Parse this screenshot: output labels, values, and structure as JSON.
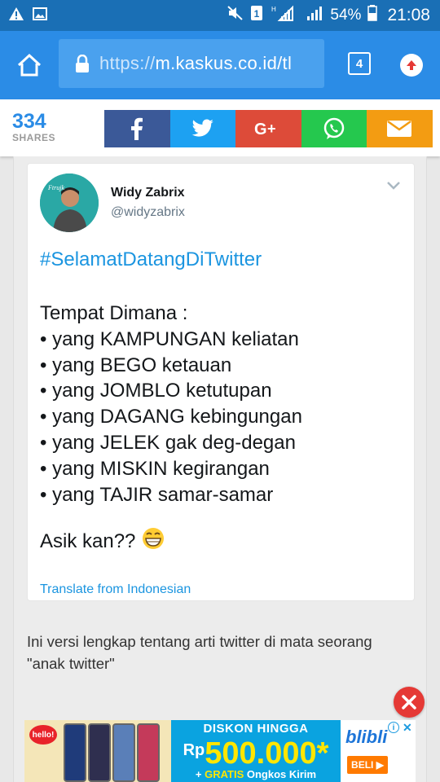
{
  "status_bar": {
    "battery_percent": "54%",
    "time": "21:08"
  },
  "browser": {
    "url_scheme": "https://",
    "url_rest": "m.kaskus.co.id/tl",
    "tab_count": "4"
  },
  "share_bar": {
    "count": "334",
    "label": "SHARES",
    "buttons": [
      {
        "name": "facebook",
        "color": "#3b5998"
      },
      {
        "name": "twitter",
        "color": "#1da1f2"
      },
      {
        "name": "google-plus",
        "color": "#dd4b39"
      },
      {
        "name": "whatsapp",
        "color": "#25c84e"
      },
      {
        "name": "email",
        "color": "#f39c12"
      }
    ]
  },
  "tweet": {
    "author_name": "Widy Zabrix",
    "author_handle": "@widyzabrix",
    "hashtag": "#SelamatDatangDiTwitter",
    "lines": [
      "Tempat Dimana :",
      "• yang KAMPUNGAN keliatan",
      "• yang BEGO ketauan",
      "• yang JOMBLO ketutupan",
      "• yang DAGANG kebingungan",
      "• yang JELEK gak deg-degan",
      "• yang MISKIN kegirangan",
      "• yang TAJIR samar-samar"
    ],
    "closing": "Asik kan??",
    "translate_label": "Translate from Indonesian"
  },
  "caption": "Ini versi lengkap tentang arti twitter di mata seorang \"anak twitter\"",
  "ad": {
    "brand_left": "hello!",
    "headline": "DISKON HINGGA",
    "currency": "Rp",
    "amount": "500.000*",
    "sub_plus": "+ ",
    "sub_gratis": "GRATIS",
    "sub_rest": " Ongkos Kirim",
    "brand_right": "blibli",
    "cta": "BELI ▶"
  },
  "colors": {
    "status_bar": "#1a6fb5",
    "browser_bar": "#2b8ce6",
    "link_blue": "#1b95e0",
    "ad_close": "#e53935"
  }
}
